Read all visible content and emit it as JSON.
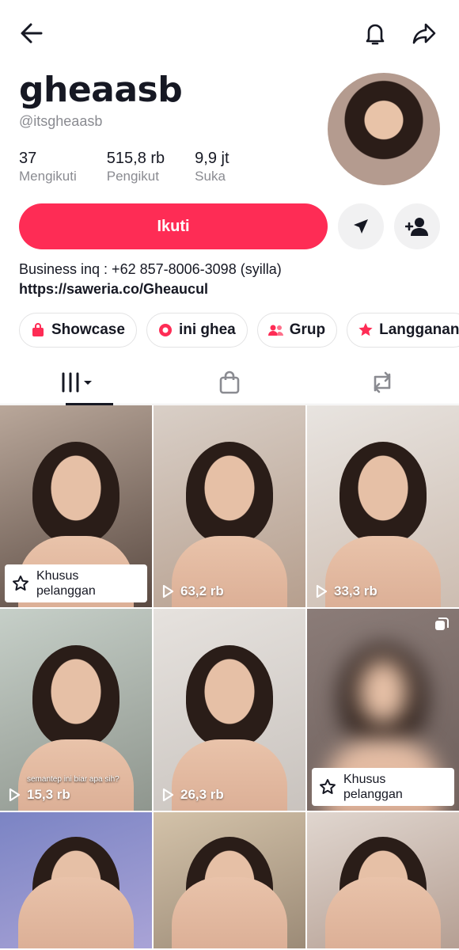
{
  "header": {
    "username": "gheaasb",
    "handle": "@itsgheaasb"
  },
  "stats": [
    {
      "value": "37",
      "label": "Mengikuti"
    },
    {
      "value": "515,8 rb",
      "label": "Pengikut"
    },
    {
      "value": "9,9 jt",
      "label": "Suka"
    }
  ],
  "actions": {
    "follow_label": "Ikuti"
  },
  "bio": {
    "text": "Business inq : +62 857-8006-3098 (syilla)",
    "link": "https://saweria.co/Gheaucul"
  },
  "chips": [
    {
      "label": "Showcase",
      "icon": "shopping-bag-icon"
    },
    {
      "label": "ini ghea",
      "icon": "chat-bubble-icon"
    },
    {
      "label": "Grup",
      "icon": "group-icon"
    },
    {
      "label": "Langganan",
      "icon": "star-icon"
    }
  ],
  "tabs": [
    {
      "icon": "videos-grid-icon",
      "active": true
    },
    {
      "icon": "shopping-bag-icon",
      "active": false
    },
    {
      "icon": "repost-icon",
      "active": false
    }
  ],
  "videos": [
    {
      "views": "",
      "badge": "Khusus pelanggan",
      "colors": [
        "#b9a79a",
        "#5a4a42"
      ]
    },
    {
      "views": "63,2 rb",
      "badge": "",
      "colors": [
        "#d9cfc7",
        "#b69f8e"
      ]
    },
    {
      "views": "33,3 rb",
      "badge": "",
      "colors": [
        "#e8e4e0",
        "#cdbdb1"
      ]
    },
    {
      "views": "15,3 rb",
      "badge": "",
      "caption": "semantep ini biar apa sih?",
      "colors": [
        "#c6cfc8",
        "#8f968e"
      ]
    },
    {
      "views": "26,3 rb",
      "badge": "",
      "colors": [
        "#e6e2de",
        "#c9c3be"
      ]
    },
    {
      "views": "",
      "badge": "Khusus pelanggan",
      "blurred": true,
      "colors": [
        "#8b7c78",
        "#6d5f5b"
      ]
    },
    {
      "views": "",
      "badge": "",
      "colors": [
        "#7b84c4",
        "#a9a3d6"
      ]
    },
    {
      "views": "",
      "badge": "",
      "colors": [
        "#d3c2a9",
        "#9c8b77"
      ]
    },
    {
      "views": "",
      "badge": "",
      "colors": [
        "#e0d6cf",
        "#b59f93"
      ]
    }
  ],
  "colors": {
    "accent": "#fe2c55",
    "text": "#161823",
    "muted": "#8a8b91"
  }
}
